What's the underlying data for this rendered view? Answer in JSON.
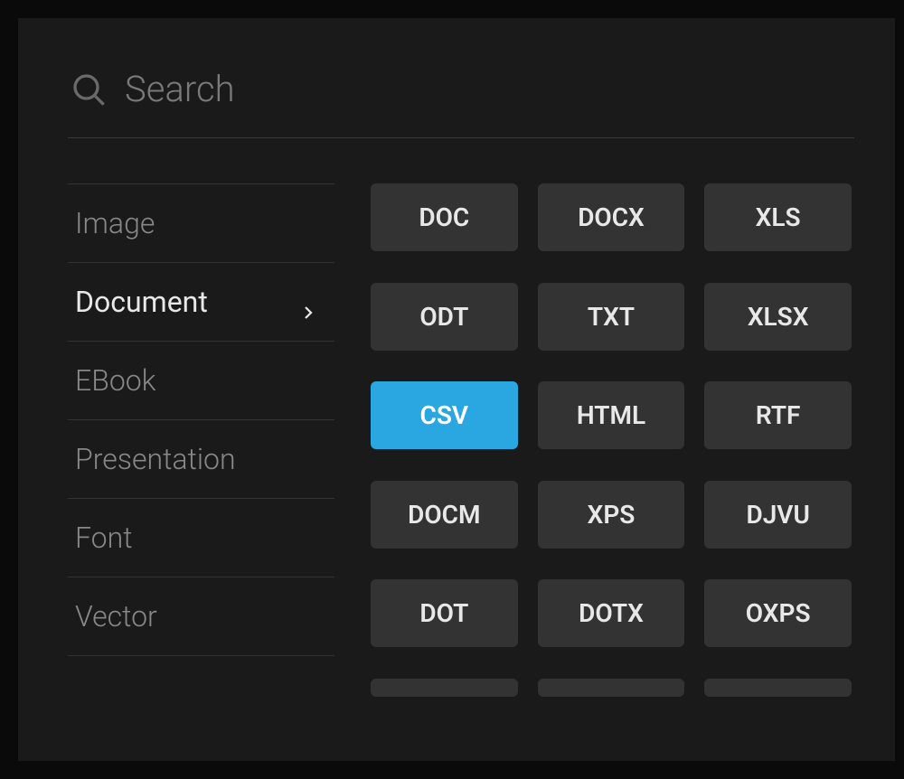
{
  "search": {
    "placeholder": "Search",
    "value": ""
  },
  "sidebar": {
    "items": [
      {
        "label": "Image",
        "active": false
      },
      {
        "label": "Document",
        "active": true
      },
      {
        "label": "EBook",
        "active": false
      },
      {
        "label": "Presentation",
        "active": false
      },
      {
        "label": "Font",
        "active": false
      },
      {
        "label": "Vector",
        "active": false
      }
    ]
  },
  "formats": [
    {
      "label": "DOC",
      "selected": false
    },
    {
      "label": "DOCX",
      "selected": false
    },
    {
      "label": "XLS",
      "selected": false
    },
    {
      "label": "ODT",
      "selected": false
    },
    {
      "label": "TXT",
      "selected": false
    },
    {
      "label": "XLSX",
      "selected": false
    },
    {
      "label": "CSV",
      "selected": true
    },
    {
      "label": "HTML",
      "selected": false
    },
    {
      "label": "RTF",
      "selected": false
    },
    {
      "label": "DOCM",
      "selected": false
    },
    {
      "label": "XPS",
      "selected": false
    },
    {
      "label": "DJVU",
      "selected": false
    },
    {
      "label": "DOT",
      "selected": false
    },
    {
      "label": "DOTX",
      "selected": false
    },
    {
      "label": "OXPS",
      "selected": false
    }
  ],
  "colors": {
    "accent": "#2aa6e0",
    "background": "#1a1a1a",
    "button_bg": "#333333",
    "text_primary": "#e8e8e8",
    "text_muted": "#888888"
  }
}
